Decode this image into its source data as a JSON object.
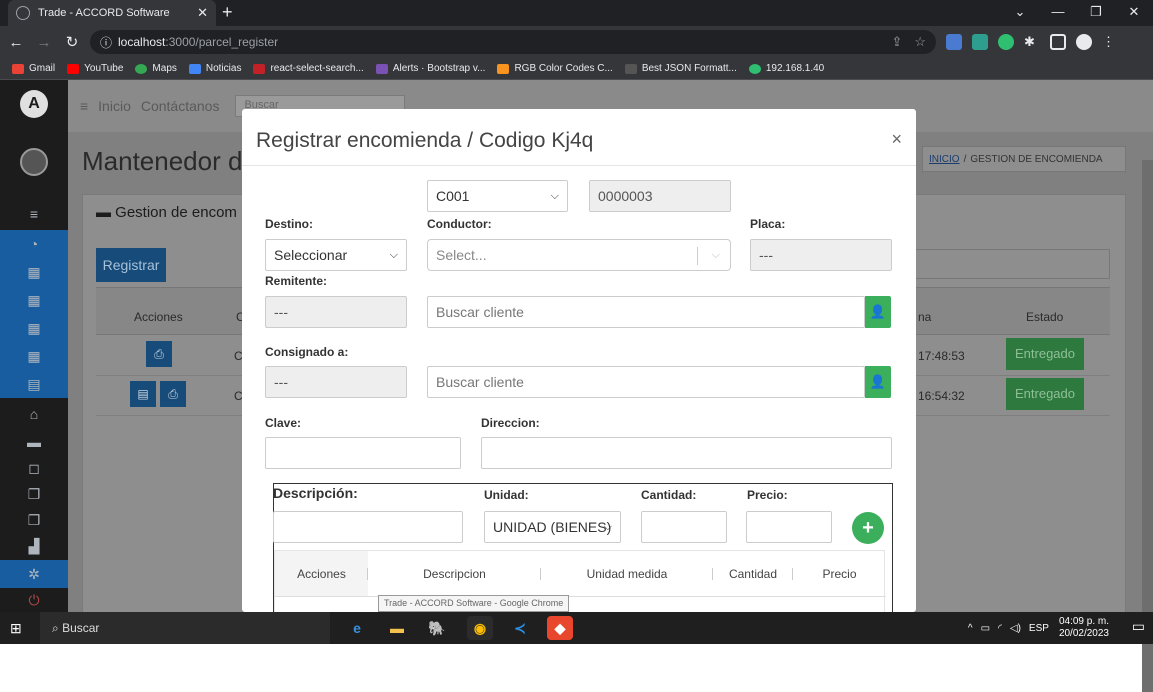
{
  "browser": {
    "tab_title": "Trade - ACCORD Software",
    "url_host": "localhost",
    "url_path": ":3000/parcel_register",
    "bookmarks": [
      "Gmail",
      "YouTube",
      "Maps",
      "Noticias",
      "react-select-search...",
      "Alerts · Bootstrap v...",
      "RGB Color Codes C...",
      "Best JSON Formatt...",
      "192.168.1.40"
    ]
  },
  "app": {
    "nav": [
      "Inicio",
      "Contáctanos"
    ],
    "search_placeholder": "Buscar",
    "page_title": "Mantenedor de",
    "breadcrumb_home": "INICIO",
    "breadcrumb_sep": "/",
    "breadcrumb_current": "GESTION DE ENCOMIENDA",
    "panel_title": "Gestion de encom",
    "register_button": "Registrar",
    "columns": [
      "Acciones",
      "C",
      "na",
      "Estado"
    ],
    "rows": [
      {
        "time": "17:48:53",
        "status": "Entregado",
        "code": "C"
      },
      {
        "time": "16:54:32",
        "status": "Entregado",
        "code": "C"
      }
    ]
  },
  "modal": {
    "title": "Registrar encomienda / Codigo Kj4q",
    "series_select": "C001",
    "number": "0000003",
    "labels": {
      "destino": "Destino:",
      "conductor": "Conductor:",
      "placa": "Placa:",
      "remitente": "Remitente:",
      "consignado": "Consignado a:",
      "clave": "Clave:",
      "direccion": "Direccion:",
      "descripcion": "Descripción:",
      "unidad": "Unidad:",
      "cantidad": "Cantidad:",
      "precio": "Precio:"
    },
    "destino_value": "Seleccionar",
    "conductor_placeholder": "Select...",
    "placa_value": "---",
    "remitente_doc": "---",
    "remitente_placeholder": "Buscar cliente",
    "consignado_doc": "---",
    "consignado_placeholder": "Buscar cliente",
    "unidad_value": "UNIDAD (BIENES)",
    "table_headers": [
      "Acciones",
      "Descripcion",
      "Unidad medida",
      "Cantidad",
      "Precio"
    ]
  },
  "tooltip": "Trade - ACCORD Software - Google Chrome",
  "taskbar": {
    "search": "Buscar",
    "lang": "ESP",
    "time": "04:09 p. m.",
    "date": "20/02/2023"
  }
}
